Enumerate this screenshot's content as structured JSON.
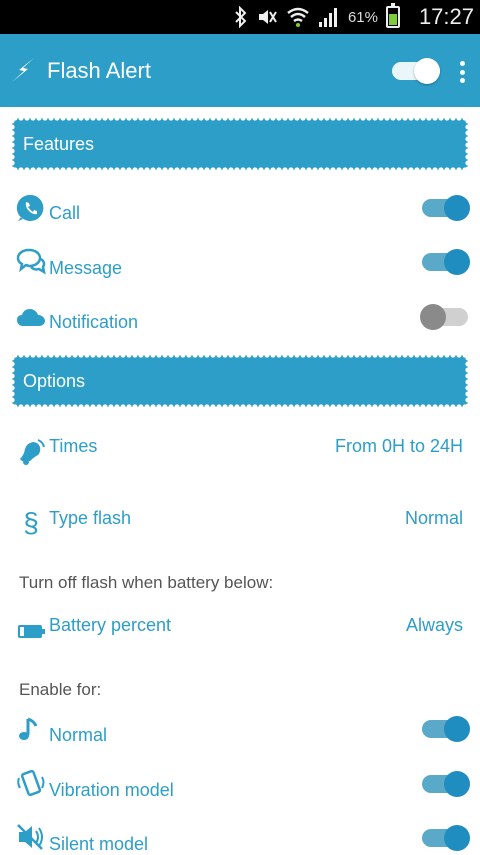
{
  "status_bar": {
    "battery_percent": "61%",
    "time": "17:27",
    "icons": [
      "bluetooth-icon",
      "mute-icon",
      "wifi-icon",
      "signal-icon",
      "battery-icon"
    ]
  },
  "app_bar": {
    "title": "Flash Alert",
    "icon": "flash-icon",
    "master_toggle": true,
    "menu_icon": "overflow-menu-icon"
  },
  "features": {
    "header": "Features",
    "items": [
      {
        "label": "Call",
        "icon": "phone-icon",
        "enabled": true
      },
      {
        "label": "Message",
        "icon": "chat-icon",
        "enabled": true
      },
      {
        "label": "Notification",
        "icon": "cloud-icon",
        "enabled": false
      }
    ]
  },
  "options": {
    "header": "Options",
    "times": {
      "label": "Times",
      "value": "From 0H to 24H",
      "icon": "bell-icon"
    },
    "type_flash": {
      "label": "Type flash",
      "value": "Normal",
      "icon": "section-icon"
    },
    "battery_note": "Turn off flash when battery below:",
    "battery": {
      "label": "Battery percent",
      "value": "Always",
      "icon": "battery-icon"
    },
    "enable_for_label": "Enable for:",
    "modes": [
      {
        "label": "Normal",
        "icon": "music-note-icon",
        "enabled": true
      },
      {
        "label": "Vibration model",
        "icon": "vibration-icon",
        "enabled": true
      },
      {
        "label": "Silent model",
        "icon": "speaker-mute-icon",
        "enabled": true
      }
    ]
  },
  "colors": {
    "primary": "#2d9ec8",
    "toggle_on_thumb": "#1f8dbf",
    "toggle_off_thumb": "#8a8a8a"
  }
}
